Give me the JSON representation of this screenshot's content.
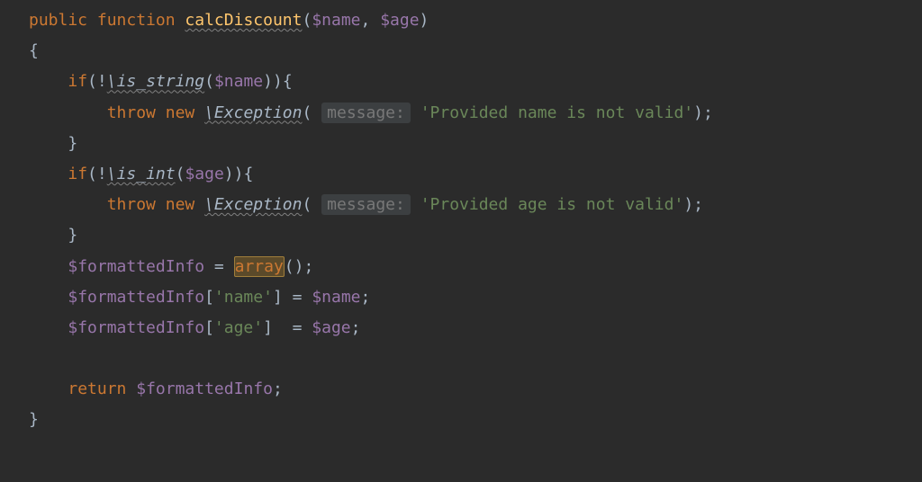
{
  "code": {
    "kw_public": "public",
    "kw_function": "function",
    "fn_name": "calcDiscount",
    "param_name": "$name",
    "param_age": "$age",
    "kw_if": "if",
    "call_is_string": "\\is_string",
    "call_is_int": "\\is_int",
    "kw_throw": "throw",
    "kw_new": "new",
    "cls_exception": "\\Exception",
    "hint_message": "message:",
    "str_name_err": "'Provided name is not valid'",
    "str_age_err": "'Provided age is not valid'",
    "var_formatted": "$formattedInfo",
    "kw_array": "array",
    "key_name": "'name'",
    "key_age": "'age'",
    "kw_return": "return"
  }
}
